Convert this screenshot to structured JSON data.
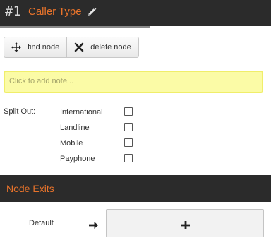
{
  "header": {
    "node_number": "#1",
    "title": "Caller Type",
    "edit_icon": "pencil-icon",
    "accent_color": "#e8732b"
  },
  "toolbar": {
    "find_label": "find node",
    "find_icon": "move-crosshair-icon",
    "delete_label": "delete node",
    "delete_icon": "x-icon"
  },
  "note": {
    "placeholder": "Click to add note..."
  },
  "split": {
    "label": "Split Out:",
    "options": [
      {
        "label": "International",
        "checked": false
      },
      {
        "label": "Landline",
        "checked": false
      },
      {
        "label": "Mobile",
        "checked": false
      },
      {
        "label": "Payphone",
        "checked": false
      }
    ]
  },
  "exits": {
    "title": "Node Exits",
    "items": [
      {
        "label": "Default",
        "arrow_icon": "arrow-right-icon",
        "add_icon": "plus-icon"
      }
    ]
  }
}
